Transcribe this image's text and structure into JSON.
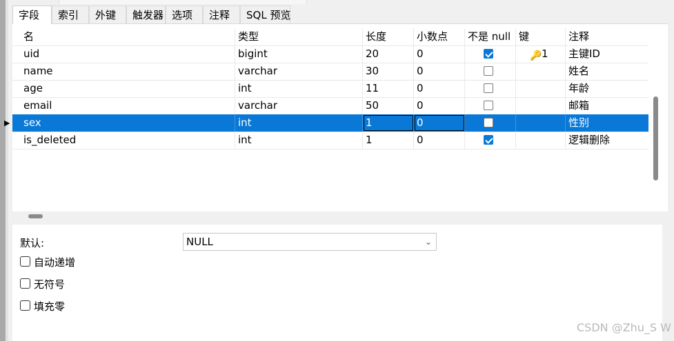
{
  "tabs": [
    {
      "label": "字段",
      "active": true
    },
    {
      "label": "索引",
      "active": false
    },
    {
      "label": "外键",
      "active": false
    },
    {
      "label": "触发器",
      "active": false
    },
    {
      "label": "选项",
      "active": false
    },
    {
      "label": "注释",
      "active": false
    },
    {
      "label": "SQL 预览",
      "active": false
    }
  ],
  "columns": [
    "名",
    "类型",
    "长度",
    "小数点",
    "不是 null",
    "键",
    "注释"
  ],
  "rows": [
    {
      "name": "uid",
      "type": "bigint",
      "length": "20",
      "decimal": "0",
      "not_null": true,
      "key": "1",
      "comment": "主键ID",
      "selected": false
    },
    {
      "name": "name",
      "type": "varchar",
      "length": "30",
      "decimal": "0",
      "not_null": false,
      "key": "",
      "comment": "姓名",
      "selected": false
    },
    {
      "name": "age",
      "type": "int",
      "length": "11",
      "decimal": "0",
      "not_null": false,
      "key": "",
      "comment": "年龄",
      "selected": false
    },
    {
      "name": "email",
      "type": "varchar",
      "length": "50",
      "decimal": "0",
      "not_null": false,
      "key": "",
      "comment": "邮箱",
      "selected": false
    },
    {
      "name": "sex",
      "type": "int",
      "length": "1",
      "decimal": "0",
      "not_null": false,
      "key": "",
      "comment": "性别",
      "selected": true
    },
    {
      "name": "is_deleted",
      "type": "int",
      "length": "1",
      "decimal": "0",
      "not_null": true,
      "key": "",
      "comment": "逻辑删除",
      "selected": false
    }
  ],
  "properties": {
    "default_label": "默认:",
    "default_value": "NULL",
    "auto_increment_label": "自动递增",
    "unsigned_label": "无符号",
    "zerofill_label": "填充零"
  },
  "icons": {
    "key": "key-icon",
    "row_pointer": "row-pointer-icon",
    "dropdown": "chevron-down-icon"
  },
  "colors": {
    "selection": "#0a78d7"
  },
  "watermark": "CSDN @Zhu_S W"
}
